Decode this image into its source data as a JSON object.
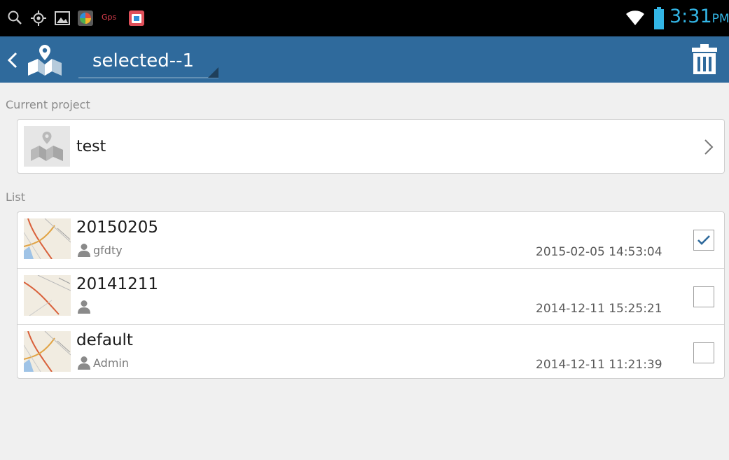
{
  "status_bar": {
    "time": "3:31",
    "ampm": "PM",
    "gps_label": "Gps",
    "time_color": "#33b5e5"
  },
  "action_bar": {
    "title": "selected--1",
    "color": "#2f6a9c"
  },
  "current_project": {
    "label": "Current project",
    "name": "test"
  },
  "list": {
    "label": "List",
    "items": [
      {
        "title": "20150205",
        "owner": "gfdty",
        "date": "2015-02-05 14:53:04",
        "checked": true
      },
      {
        "title": "20141211",
        "owner": "",
        "date": "2014-12-11 15:25:21",
        "checked": false
      },
      {
        "title": "default",
        "owner": "Admin",
        "date": "2014-12-11 11:21:39",
        "checked": false
      }
    ]
  }
}
